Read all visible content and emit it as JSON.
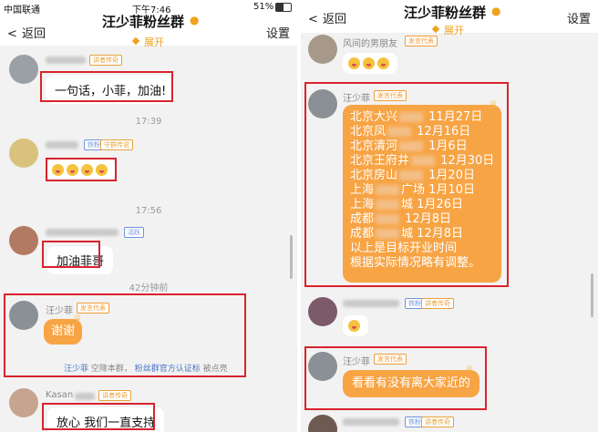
{
  "left": {
    "status": {
      "carrier": "中国联通",
      "time": "下午7:46",
      "battery": "51%"
    },
    "nav": {
      "back": "返回",
      "title": "汪少菲粉丝群",
      "expand": "展开",
      "settings": "设置"
    },
    "messages": [
      {
        "tags": [
          "讲者传奇"
        ],
        "text": "一句话，小菲，加油!"
      },
      {
        "time": "17:39"
      },
      {
        "tags": [
          "铁粉",
          "守群传说"
        ],
        "emoji_count": 4
      },
      {
        "time": "17:56"
      },
      {
        "tags": [
          "活跃"
        ],
        "text": "加油菲哥"
      },
      {
        "time": "42分钟前"
      },
      {
        "sender": "汪少菲",
        "tags": [
          "发言代表"
        ],
        "text": "谢谢"
      },
      {
        "system": {
          "name": "汪少菲",
          "mid": "空降本群，",
          "link": "粉丝群官方认证标",
          "end": "被点亮"
        }
      },
      {
        "sender_prefix": "Kasan",
        "tags": [
          "讲者传奇"
        ],
        "text": "放心 我们一直支持"
      }
    ]
  },
  "right": {
    "nav": {
      "back": "返回",
      "title": "汪少菲粉丝群",
      "expand": "展开",
      "settings": "设置"
    },
    "messages": [
      {
        "sender": "风间的男朋友",
        "tags": [
          "发言代表"
        ],
        "emoji_count": 3
      },
      {
        "sender": "汪少菲",
        "tags": [
          "发言代表"
        ],
        "lines": [
          {
            "a": "北京大兴",
            "b": "11月27日"
          },
          {
            "a": "北京凤",
            "b": "12月16日"
          },
          {
            "a": "北京清河",
            "b": "1月6日"
          },
          {
            "a": "北京王府井",
            "b": "12月30日"
          },
          {
            "a": "北京房山",
            "b": "1月20日"
          },
          {
            "a": "上海",
            "b": "广场   1月10日"
          },
          {
            "a": "上海",
            "b": "城   1月26日"
          },
          {
            "a": "成都",
            "b": "12月8日"
          },
          {
            "a": "成都",
            "b": "城   12月8日"
          }
        ],
        "footer": [
          "以上是目标开业时间",
          "根据实际情况略有调整。"
        ]
      },
      {
        "tags": [
          "铁粉",
          "讲者传奇"
        ],
        "emoji_count": 1
      },
      {
        "sender": "汪少菲",
        "tags": [
          "发言代表"
        ],
        "text": "看看有没有离大家近的"
      },
      {
        "tags": [
          "铁粉",
          "讲者传奇"
        ]
      }
    ]
  }
}
